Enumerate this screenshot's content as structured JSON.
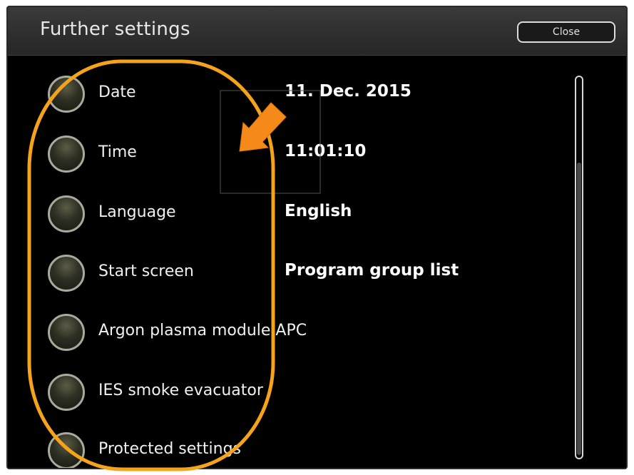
{
  "header": {
    "title": "Further settings",
    "close_label": "Close"
  },
  "settings": [
    {
      "label": "Date",
      "value": "11. Dec. 2015"
    },
    {
      "label": "Time",
      "value": "11:01:10"
    },
    {
      "label": "Language",
      "value": "English"
    },
    {
      "label": "Start screen",
      "value": "Program group list"
    },
    {
      "label": "Argon plasma module APC",
      "value": ""
    },
    {
      "label": "IES smoke evacuator",
      "value": ""
    },
    {
      "label": "Protected settings",
      "value": ""
    }
  ],
  "colors": {
    "highlight": "#f5a31a",
    "background": "#000000",
    "knob": "#3a3b2c"
  },
  "annotations": {
    "highlight_shape": "rounded-oval around setting buttons",
    "arrow": "orange arrow pointing toward button column",
    "focus_box": "thin grey rectangle"
  }
}
